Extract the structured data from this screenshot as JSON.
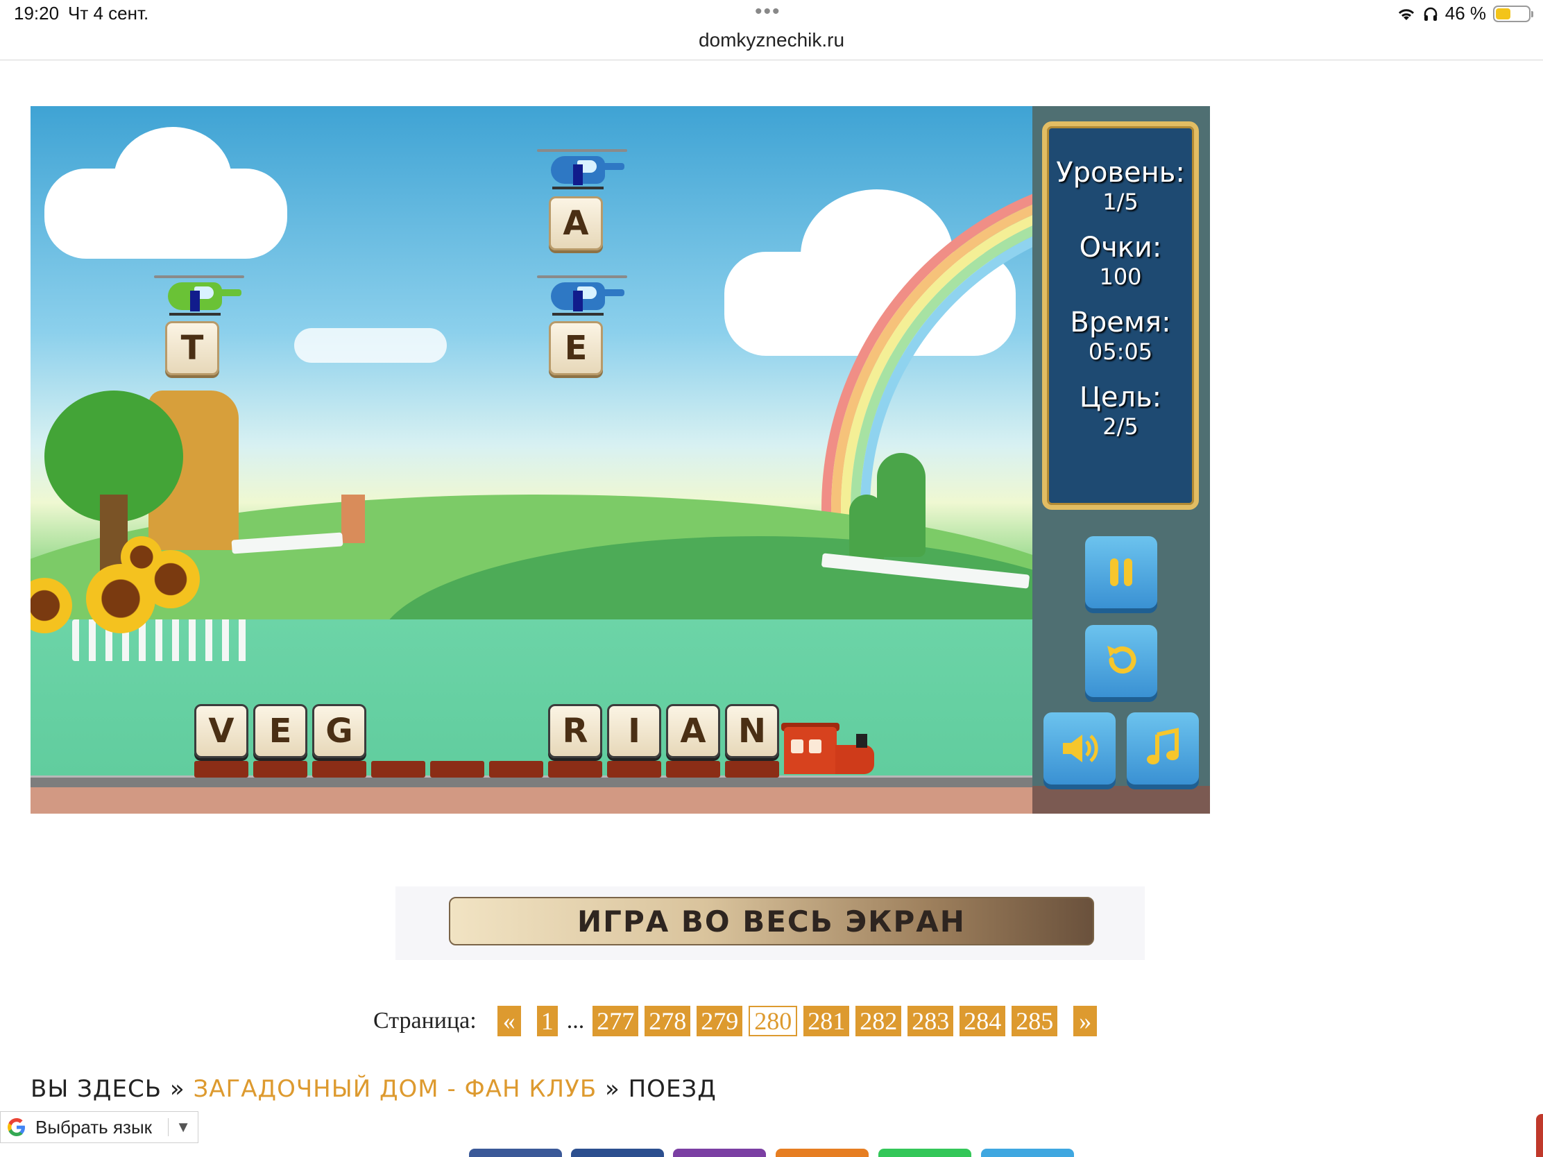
{
  "status_bar": {
    "time": "19:20",
    "date": "Чт 4 сент.",
    "url": "domkyznechik.ru",
    "battery": "46 %",
    "battery_level": 0.46
  },
  "game": {
    "falling_letters": [
      "T",
      "A",
      "E"
    ],
    "train_letters_left": [
      "V",
      "E",
      "G"
    ],
    "train_letters_right": [
      "R",
      "I",
      "A",
      "N"
    ],
    "panel": {
      "level_label": "Уровень:",
      "level_value": "1/5",
      "score_label": "Очки:",
      "score_value": "100",
      "time_label": "Время:",
      "time_value": "05:05",
      "goal_label": "Цель:",
      "goal_value": "2/5"
    }
  },
  "fullscreen_label": "ИГРА ВО ВЕСЬ ЭКРАН",
  "pagination": {
    "label": "Страница:",
    "prev": "«",
    "first": "1",
    "ellipsis": "...",
    "pages_before": [
      "277",
      "278",
      "279"
    ],
    "current": "280",
    "pages_after": [
      "281",
      "282",
      "283",
      "284",
      "285"
    ],
    "next": "»"
  },
  "breadcrumb": {
    "prefix": "ВЫ ЗДЕСЬ",
    "sep": "»",
    "link": "ЗАГАДОЧНЫЙ ДОМ - ФАН КЛУБ",
    "current": "ПОЕЗД"
  },
  "translate": {
    "label": "Выбрать язык",
    "caret": "▼"
  },
  "colors": {
    "accent": "#dd9a2f",
    "panel_blue": "#1e4a72",
    "gold_frame": "#e2bd63"
  },
  "share_colors": [
    "#3b5998",
    "#2c4f8f",
    "#7b3fa3",
    "#e67e22",
    "#34c759",
    "#3fa7e0"
  ]
}
